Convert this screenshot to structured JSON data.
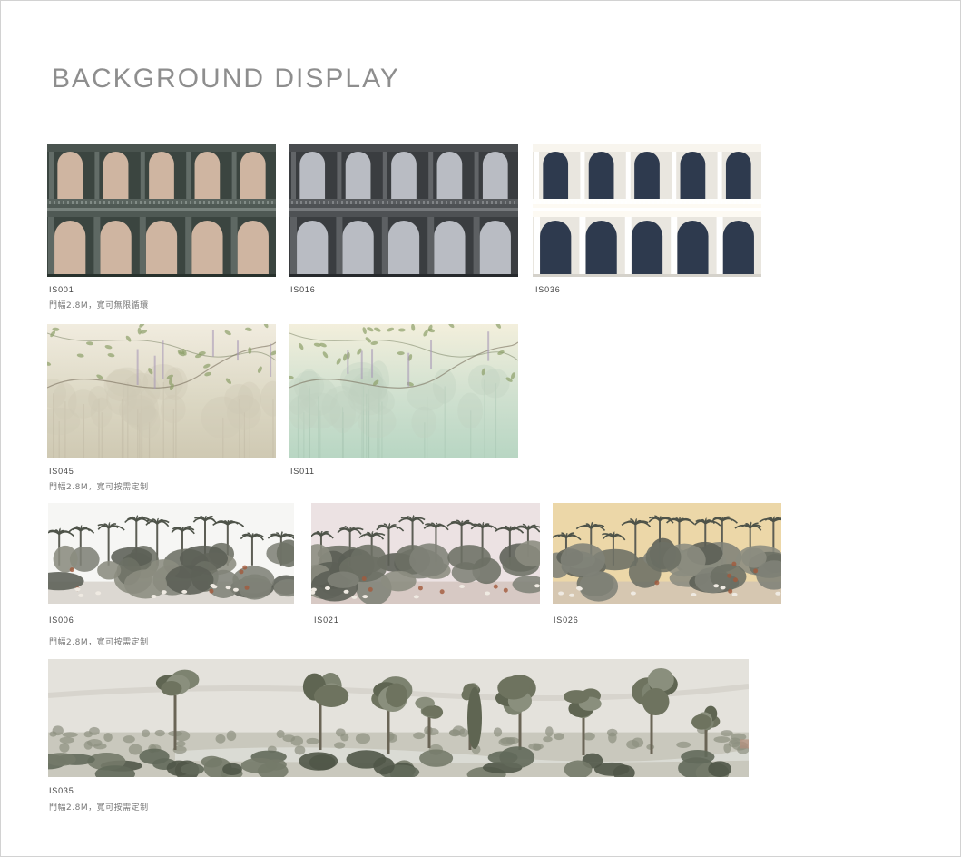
{
  "title": "BACKGROUND DISPLAY",
  "rows": [
    {
      "note": "門幅2.8M，寬可無限循環",
      "items": [
        {
          "code": "IS001",
          "pattern": "arcade",
          "arch_fill": "#cfb5a1",
          "frame": "#3b4540"
        },
        {
          "code": "IS016",
          "pattern": "arcade",
          "arch_fill": "#b9bcc3",
          "frame": "#3a3d40"
        },
        {
          "code": "IS036",
          "pattern": "arcade",
          "arch_fill": "#2e3a4e",
          "frame": "#e9e6df"
        }
      ]
    },
    {
      "note": "門幅2.8M，寬可按需定制",
      "items": [
        {
          "code": "IS045",
          "pattern": "misty-forest",
          "sky": "#f1ecdf",
          "mist": "#dcd8c4",
          "ground": "#cfc9b3"
        },
        {
          "code": "IS011",
          "pattern": "misty-forest",
          "sky": "#f3efdc",
          "mist": "#cfe0cf",
          "ground": "#b8d6c3"
        }
      ]
    },
    {
      "note": "門幅2.8M，寬可按需定制",
      "items": [
        {
          "code": "IS006",
          "pattern": "jungle",
          "sky": "#f6f6f4",
          "ground": "#dcd8d2"
        },
        {
          "code": "IS021",
          "pattern": "jungle",
          "sky": "#ece2e3",
          "ground": "#d7c9c4"
        },
        {
          "code": "IS026",
          "pattern": "jungle",
          "sky": "#ecd7a8",
          "ground": "#d6c7b1"
        }
      ]
    },
    {
      "note": "門幅2.8M，寬可按需定制",
      "items": [
        {
          "code": "IS035",
          "pattern": "landscape",
          "sky": "#e4e2dc",
          "ground": "#c9c8bd"
        }
      ]
    }
  ]
}
